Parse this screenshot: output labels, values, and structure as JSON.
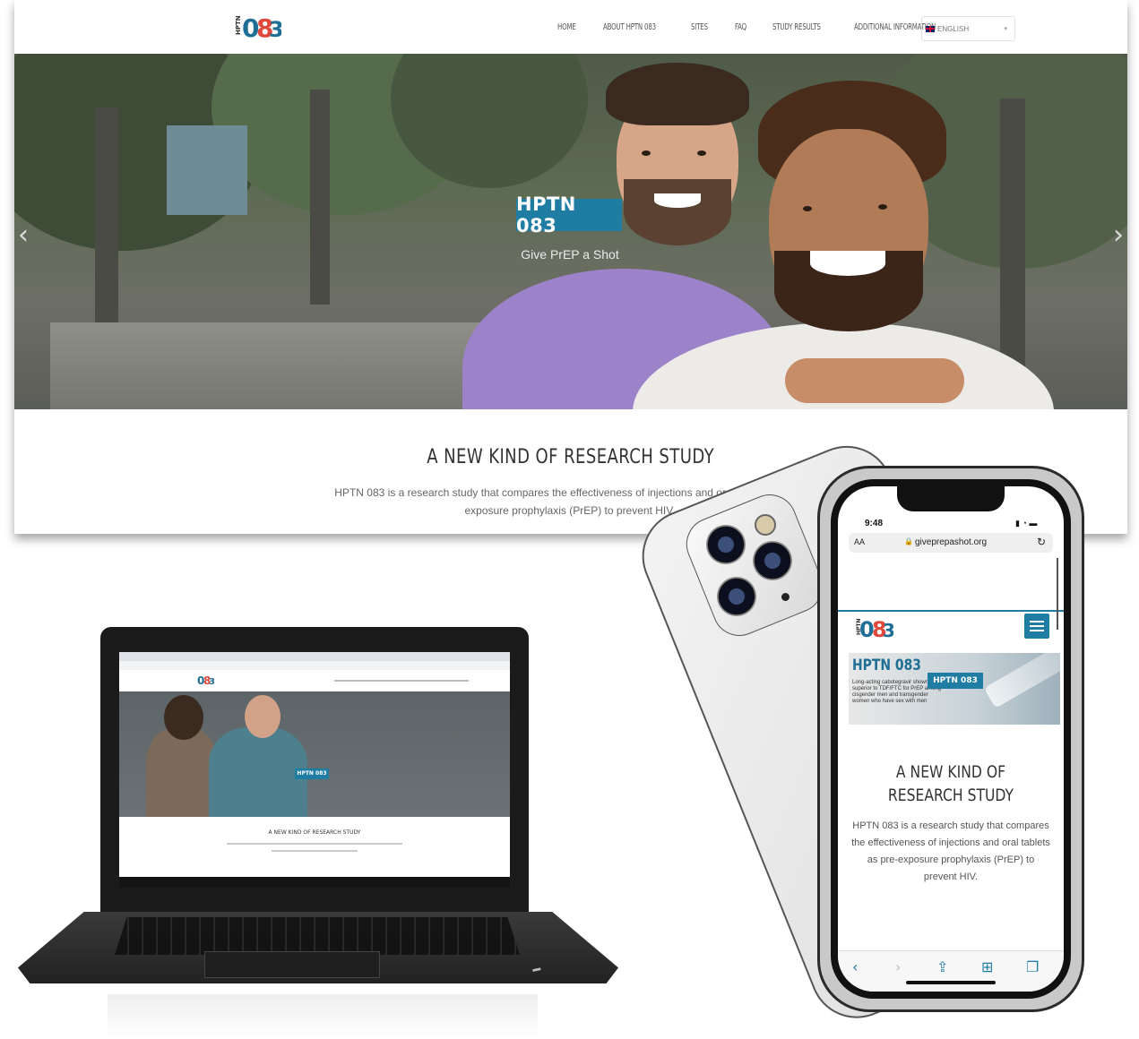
{
  "desktop": {
    "logo_text": "HPTN 083",
    "nav": [
      "HOME",
      "ABOUT HPTN 083",
      "SITES",
      "FAQ",
      "STUDY RESULTS",
      "ADDITIONAL INFORMATION"
    ],
    "language": "ENGLISH",
    "hero_title": "HPTN 083",
    "hero_subtitle": "Give PrEP a Shot",
    "section_title": "A NEW KIND OF RESEARCH STUDY",
    "section_text": "HPTN 083 is a research study that compares the effectiveness of injections and oral tablets as pre-exposure prophylaxis (PrEP) to prevent HIV."
  },
  "laptop": {
    "hero_title": "HPTN 083",
    "section_title": "A NEW KIND OF RESEARCH STUDY"
  },
  "phone": {
    "time": "9:48",
    "url_aa": "AA",
    "url": "giveprepashot.org",
    "banner_title": "HPTN 083",
    "banner_text": "Long-acting cabotegravir shown to be superior to TDF/FTC for PrEP among cisgender men and transgender women who have sex with men",
    "banner_badge": "HPTN 083",
    "section_title": "A NEW KIND OF RESEARCH STUDY",
    "section_text": "HPTN 083 is a research study that compares the effectiveness of injections and oral tablets as pre-exposure prophylaxis (PrEP) to prevent HIV."
  },
  "colors": {
    "brand_blue": "#1f7ca3",
    "logo_red": "#e0483b"
  }
}
